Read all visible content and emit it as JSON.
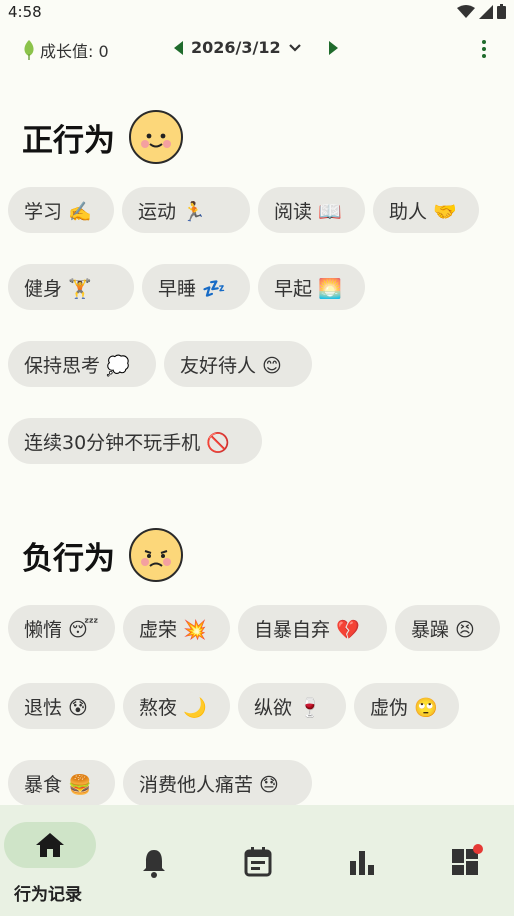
{
  "status": {
    "time": "4:58"
  },
  "header": {
    "growth_label": "成长值: 0",
    "date": "2026/3/12"
  },
  "positive": {
    "title": "正行为",
    "chips": [
      {
        "label": "学习 ✍️"
      },
      {
        "label": "运动 🏃"
      },
      {
        "label": "阅读 📖"
      },
      {
        "label": "助人 🤝"
      },
      {
        "label": "健身 🏋️"
      },
      {
        "label": "早睡 💤"
      },
      {
        "label": "早起 🌅"
      },
      {
        "label": "保持思考 💭"
      },
      {
        "label": "友好待人 😊"
      },
      {
        "label": "连续30分钟不玩手机 🚫"
      }
    ]
  },
  "negative": {
    "title": "负行为",
    "chips": [
      {
        "label": "懒惰 😴"
      },
      {
        "label": "虚荣 💥"
      },
      {
        "label": "自暴自弃 💔"
      },
      {
        "label": "暴躁 😣"
      },
      {
        "label": "退怯 😰"
      },
      {
        "label": "熬夜 🌙"
      },
      {
        "label": "纵欲 🍷"
      },
      {
        "label": "虚伪 🙄"
      },
      {
        "label": "暴食 🍔"
      },
      {
        "label": "消费他人痛苦 😓"
      }
    ]
  },
  "nav": {
    "active_label": "行为记录"
  },
  "icons": [
    "leaf-icon",
    "caret-left-icon",
    "chevron-down-icon",
    "caret-right-icon",
    "more-vert-icon",
    "home-icon",
    "bell-icon",
    "calendar-icon",
    "bar-chart-icon",
    "dashboard-icon"
  ],
  "colors": {
    "accent": "#1f6b2c",
    "chip_bg": "#e8e8e3",
    "nav_bg": "#e9f1e3",
    "badge": "#e53935"
  }
}
